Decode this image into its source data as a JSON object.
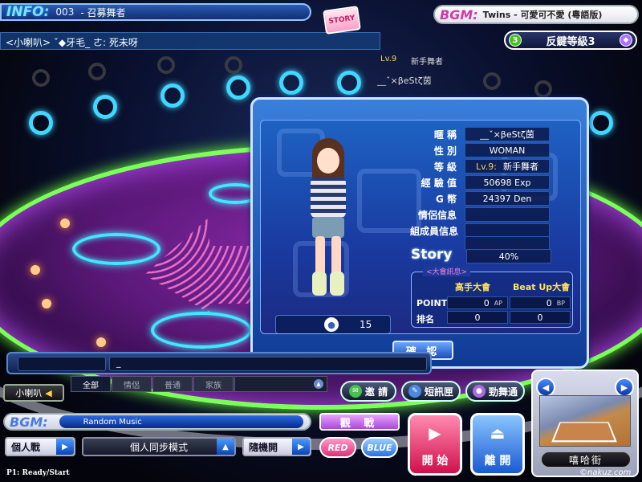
{
  "top": {
    "info_logo": "INFO:",
    "room_number": "003",
    "room_name": "- 召募舞者",
    "chat_message": "<小喇叭> ˇ◆牙毛_ ㄜ: 死未呀",
    "story_icon_text": "STORY",
    "bgm_logo": "BGM:",
    "bgm_song": "Twins - 可愛可不愛 (粵語版)",
    "level_number": "3",
    "level_text": "反鍵等級3"
  },
  "floor_player": {
    "level": "Lv.9",
    "rank": "新手舞者",
    "name": "__ˇ×βeStζ茵"
  },
  "profile": {
    "avatar_count": "15",
    "fields": [
      {
        "label": "暱 稱",
        "value": "__ˇ×βeStζ茵"
      },
      {
        "label": "性 別",
        "value": "WOMAN"
      },
      {
        "label": "等 級",
        "value": "新手舞者",
        "tag": "Lv.9:"
      },
      {
        "label": "經 驗 值",
        "value": "50698 Exp"
      },
      {
        "label": "G 幣",
        "value": "24397 Den"
      },
      {
        "label": "情侶信息",
        "value": ""
      },
      {
        "label": "組成員信息",
        "value": ""
      },
      {
        "label": "",
        "value": ""
      }
    ],
    "story_label": "Story",
    "story_value": "40%",
    "tournament": {
      "title": "<大會訊息>",
      "col1": "高手大會",
      "col2": "Beat Up大會",
      "point_label": "POINT",
      "rank_label": "排名",
      "point1": "0",
      "point1_unit": "AP",
      "point2": "0",
      "point2_unit": "BP",
      "rank1": "0",
      "rank2": "0"
    },
    "confirm": "確 認"
  },
  "chat": {
    "input_value": "_",
    "tabs": [
      "全部",
      "情侶",
      "普通",
      "家族"
    ],
    "speaker": "小喇叭"
  },
  "menu": {
    "invite": "邀 請",
    "sms": "短訊匣",
    "dance": "勁舞通"
  },
  "controls": {
    "bgm_logo": "BGM:",
    "bgm_song": "Random Music",
    "watch": "觀 戰",
    "battle_mode": "個人戰",
    "sync_mode": "個人同步模式",
    "random": "隨機開",
    "red": "RED",
    "blue": "BLUE",
    "start": "開 始",
    "leave": "離 開",
    "status": "P1: Ready/Start"
  },
  "location": {
    "name": "嘻哈街"
  },
  "watermark": "©nakuz.com",
  "colors": {
    "accent_blue": "#1c4cb4",
    "accent_pink": "#d03aa8",
    "floor_green": "#7cff5a"
  }
}
